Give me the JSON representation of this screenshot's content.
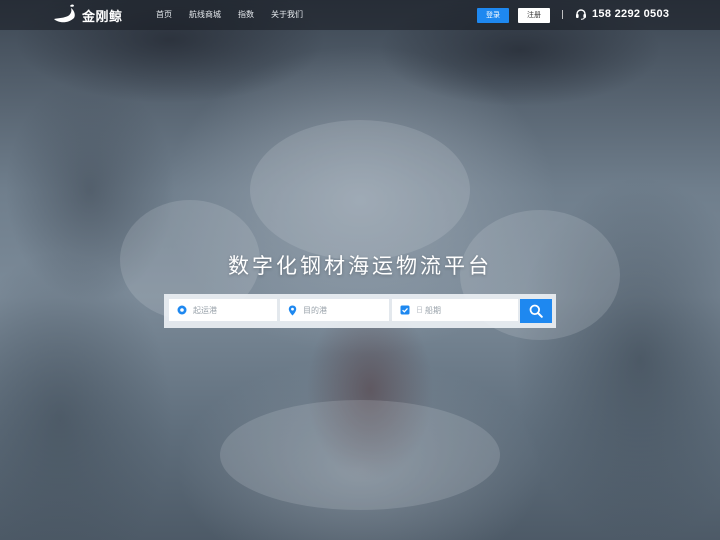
{
  "header": {
    "brand": "金刚鲸",
    "nav": [
      {
        "label": "首页"
      },
      {
        "label": "航线商城"
      },
      {
        "label": "指数"
      },
      {
        "label": "关于我们"
      }
    ],
    "login_label": "登录",
    "register_label": "注册",
    "phone_icon": "headset-icon",
    "phone_number": "158 2292 0503"
  },
  "hero": {
    "title": "数字化钢材海运物流平台"
  },
  "search": {
    "origin_placeholder": "起运港",
    "origin_icon": "circle-dot-icon",
    "destination_placeholder": "目的港",
    "destination_icon": "map-pin-icon",
    "date_prefix": "日",
    "date_placeholder": "船期",
    "date_icon": "calendar-check-icon",
    "button_icon": "search-icon"
  },
  "colors": {
    "accent": "#1e88f0",
    "header_bg": "#1a1e24",
    "title_text": "#ffffff"
  }
}
